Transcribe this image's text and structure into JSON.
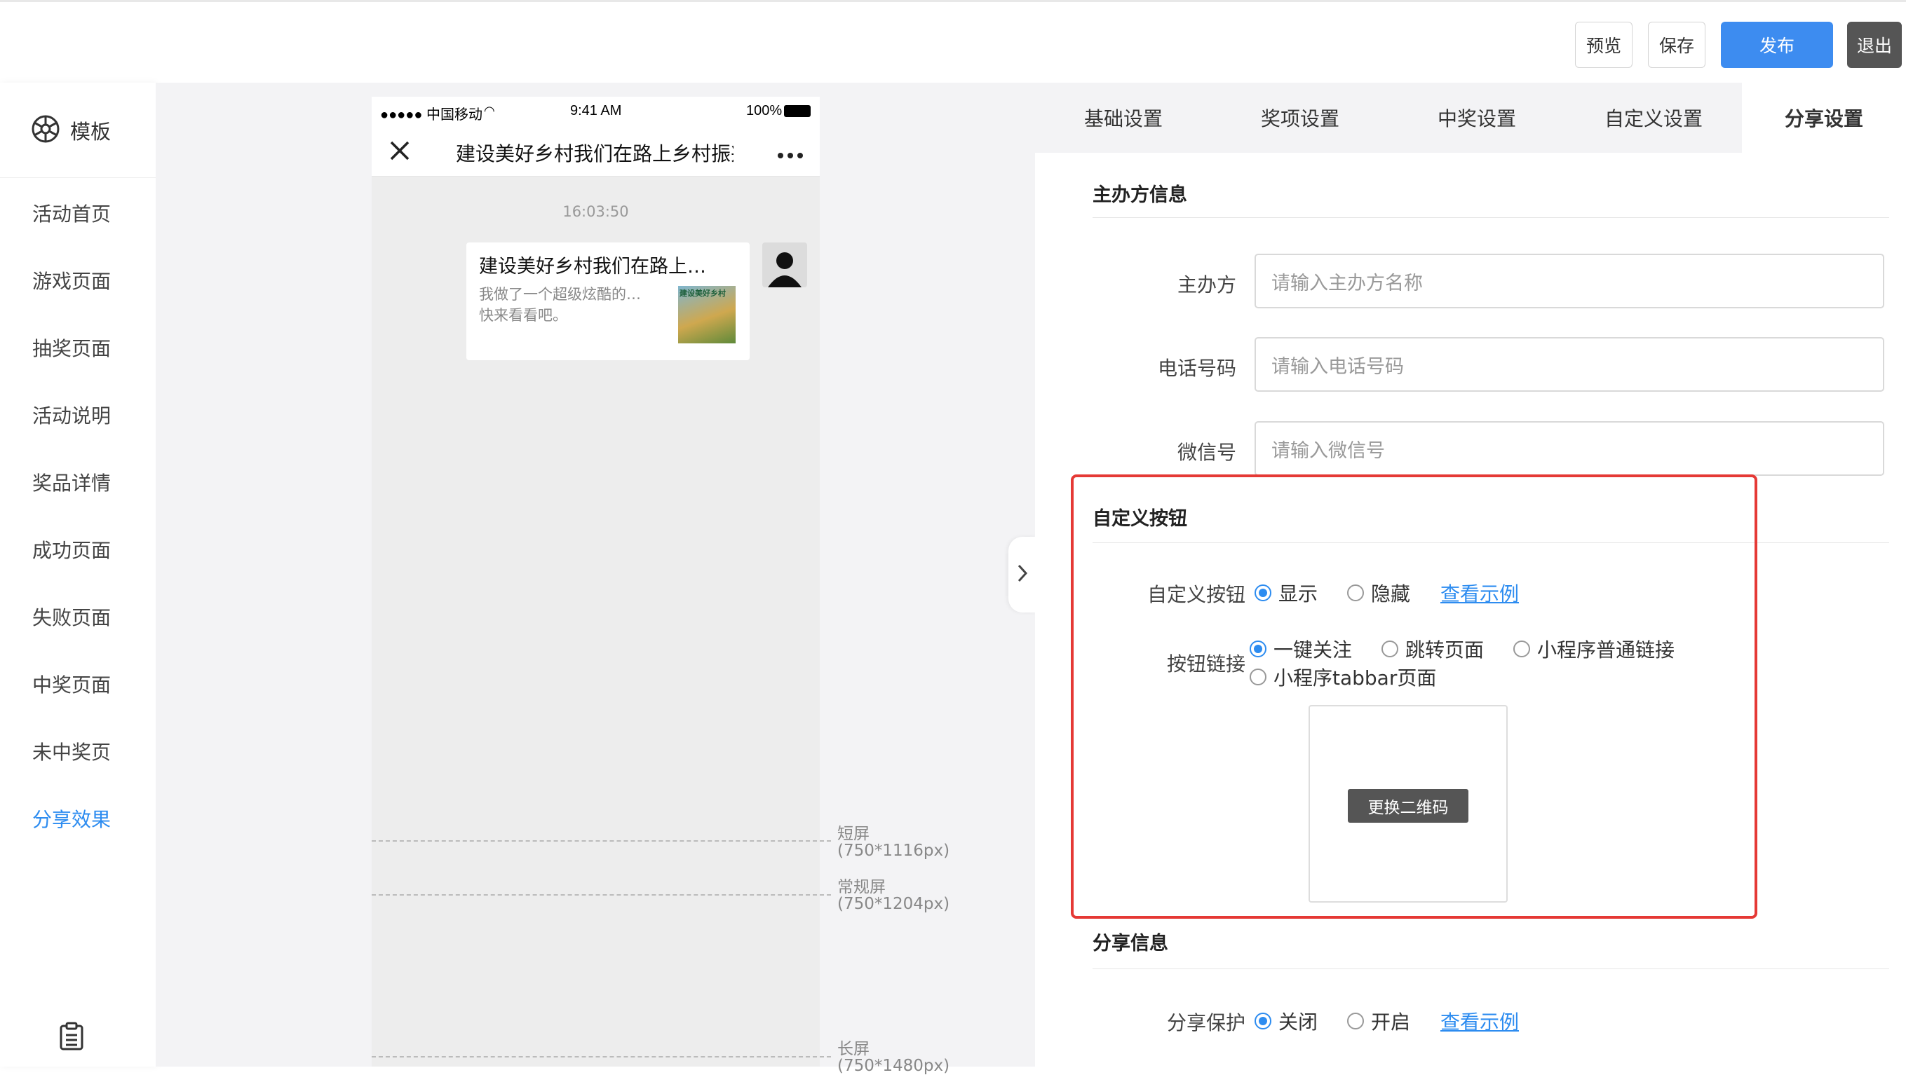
{
  "toolbar": {
    "preview": "预览",
    "save": "保存",
    "publish": "发布",
    "exit": "退出"
  },
  "sidebar": {
    "title": "模板",
    "items": [
      "活动首页",
      "游戏页面",
      "抽奖页面",
      "活动说明",
      "奖品详情",
      "成功页面",
      "失败页面",
      "中奖页面",
      "未中奖页",
      "分享效果"
    ],
    "active_index": 9
  },
  "phone": {
    "carrier": "●●●●● 中国移动",
    "time": "9:41 AM",
    "battery": "100%",
    "nav_title": "建设美好乡村我们在路上乡村振兴",
    "msg_time": "16:03:50",
    "card_title": "建设美好乡村我们在路上…",
    "card_desc1": "我做了一个超级炫酷的…",
    "card_desc2": "快来看看吧。",
    "thumb_text": "建设美好乡村"
  },
  "guides": [
    {
      "name": "短屏",
      "size": "(750*1116px)"
    },
    {
      "name": "常规屏",
      "size": "(750*1204px)"
    },
    {
      "name": "长屏",
      "size": "(750*1480px)"
    }
  ],
  "tabs": [
    "基础设置",
    "奖项设置",
    "中奖设置",
    "自定义设置",
    "分享设置"
  ],
  "active_tab": 4,
  "organizer": {
    "section_title": "主办方信息",
    "fields": [
      {
        "label": "主办方",
        "placeholder": "请输入主办方名称"
      },
      {
        "label": "电话号码",
        "placeholder": "请输入电话号码"
      },
      {
        "label": "微信号",
        "placeholder": "请输入微信号"
      }
    ]
  },
  "custom_button": {
    "section_title": "自定义按钮",
    "label": "自定义按钮",
    "options": [
      "显示",
      "隐藏"
    ],
    "selected": 0,
    "example_link": "查看示例",
    "link_label": "按钮链接",
    "link_options": [
      "一键关注",
      "跳转页面",
      "小程序普通链接",
      "小程序tabbar页面"
    ],
    "link_selected": 0,
    "qr_button": "更换二维码"
  },
  "share_info": {
    "section_title": "分享信息",
    "label": "分享保护",
    "options": [
      "关闭",
      "开启"
    ],
    "selected": 0,
    "example_link": "查看示例"
  },
  "colors": {
    "accent": "#2d8cf0",
    "highlight": "#e53935"
  }
}
